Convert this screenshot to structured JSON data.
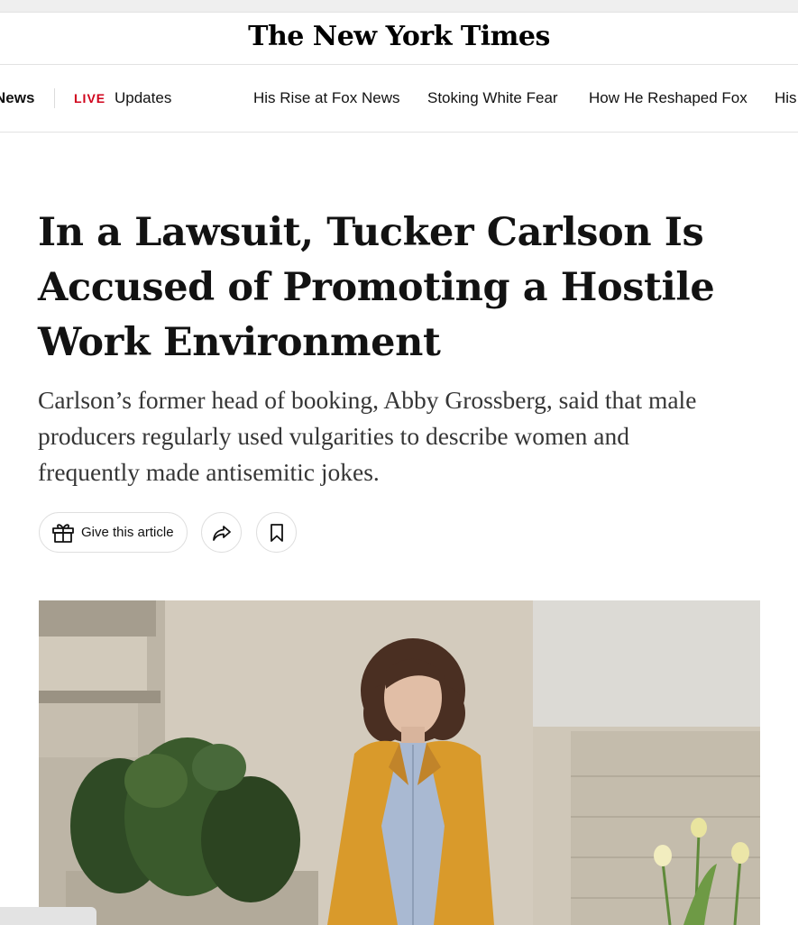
{
  "masthead": {
    "logo_text": "The New York Times"
  },
  "subnav": {
    "section": "News",
    "live_badge": "LIVE",
    "live_label": "Updates",
    "links": [
      "His Rise at Fox News",
      "Stoking White Fear",
      "How He Reshaped Fox",
      "His"
    ]
  },
  "article": {
    "headline_lines": [
      "In a Lawsuit, Tucker Carlson Is",
      "Accused of Promoting a Hostile",
      "Work Environment"
    ],
    "summary_lines": [
      "Carlson’s former head of booking, Abby Grossberg, said that male",
      "producers regularly used vulgarities to describe women and",
      "frequently made antisemitic jokes."
    ],
    "give_label": "Give this article"
  },
  "icons": {
    "gift": "gift-icon",
    "share": "share-arrow-icon",
    "bookmark": "bookmark-icon"
  },
  "colors": {
    "live_red": "#d0021b",
    "jacket_mustard": "#d99a2b",
    "shirt_blue": "#a9b9d2",
    "text_dark": "#121212",
    "summary_gray": "#363636",
    "border_light": "#e2e2e2"
  }
}
